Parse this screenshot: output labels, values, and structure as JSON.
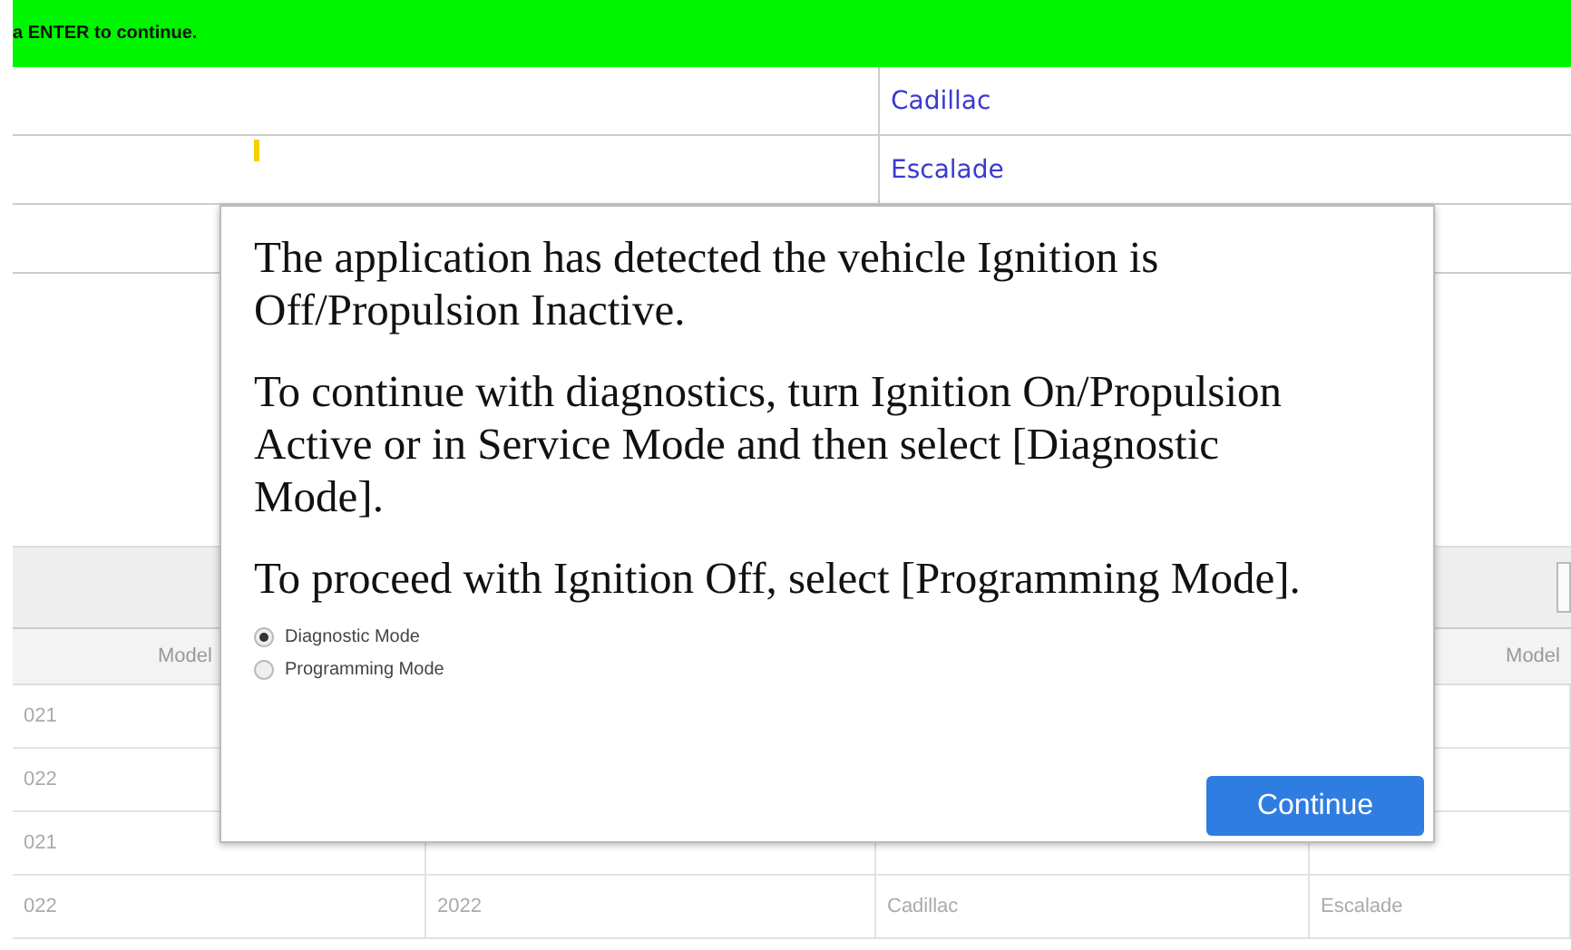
{
  "banner": {
    "text": "a ENTER to continue."
  },
  "vehicle_table": {
    "rows": [
      {
        "label": "",
        "value": "Cadillac"
      },
      {
        "label": "",
        "value": "Escalade"
      },
      {
        "label": "",
        "value": ""
      }
    ]
  },
  "list_table": {
    "headers": [
      {
        "label": "Model",
        "kind": "leading"
      },
      {
        "label": "Model",
        "kind": "trailing"
      }
    ],
    "rows": [
      {
        "cells": [
          "021",
          "",
          "",
          ""
        ]
      },
      {
        "cells": [
          "022",
          "",
          "",
          ""
        ]
      },
      {
        "cells": [
          "021",
          "",
          "",
          ""
        ]
      },
      {
        "cells": [
          "022",
          "2022",
          "Cadillac",
          "Escalade"
        ]
      }
    ]
  },
  "dialog": {
    "paragraphs": [
      "The application has detected the vehicle Ignition is Off/Propulsion Inactive.",
      "To continue with diagnostics, turn Ignition On/Propulsion Active or in Service Mode and then select [Diagnostic Mode].",
      "To proceed with Ignition Off, select [Programming Mode]."
    ],
    "options": [
      {
        "label": "Diagnostic Mode",
        "selected": true
      },
      {
        "label": "Programming Mode",
        "selected": false
      }
    ],
    "button": "Continue"
  }
}
